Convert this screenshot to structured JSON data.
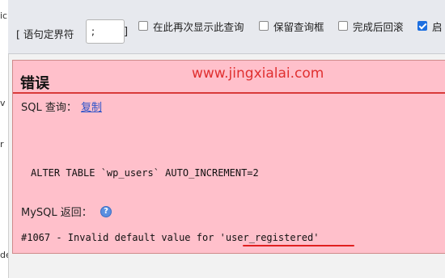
{
  "sidebar": {
    "fragments": [
      "ic",
      "v",
      "r",
      "de"
    ]
  },
  "options_bar": {
    "delimiter_label": "[ 语句定界符",
    "delimiter_value": ";",
    "bracket_close": "]",
    "options": [
      {
        "label": "在此再次显示此查询",
        "checked": false
      },
      {
        "label": "保留查询框",
        "checked": false
      },
      {
        "label": "完成后回滚",
        "checked": false
      },
      {
        "label": "启",
        "checked": true
      }
    ]
  },
  "error_panel": {
    "title": "错误",
    "watermark": "www.jingxialai.com",
    "sql_label": "SQL 查询：",
    "copy_link": "复制",
    "query": "ALTER TABLE `wp_users` AUTO_INCREMENT=2",
    "mysql_label": "MySQL 返回：",
    "help_icon": "help-icon",
    "error_message": "#1067 - Invalid default value for 'user_registered'",
    "highlight_color": "#e02020"
  },
  "colors": {
    "panel_bg": "#ffc0cb",
    "accent_red": "#d93a3a",
    "link": "#2a52c9",
    "checkbox_checked": "#1d6fe0"
  }
}
